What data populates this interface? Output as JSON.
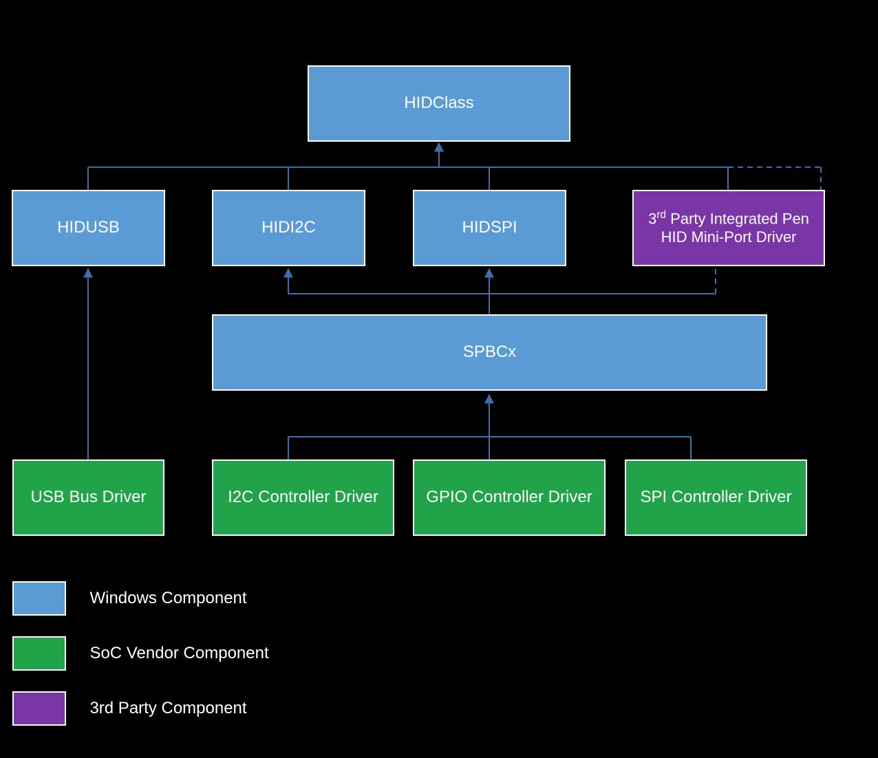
{
  "diagram": {
    "boxes": {
      "hidclass": "HIDClass",
      "hidusb": "HIDUSB",
      "hidi2c": "HIDI2C",
      "hidspi": "HIDSPI",
      "thirdparty_line1": "3",
      "thirdparty_sup": "rd",
      "thirdparty_rest1": " Party Integrated Pen",
      "thirdparty_line2": "HID Mini-Port Driver",
      "spbcx": "SPBCx",
      "usb_bus": "USB Bus Driver",
      "i2c_ctrl": "I2C Controller Driver",
      "gpio_ctrl": "GPIO Controller Driver",
      "spi_ctrl": "SPI Controller Driver"
    },
    "legend": {
      "windows": "Windows Component",
      "soc": "SoC Vendor Component",
      "thirdparty": "3rd Party Component"
    },
    "colors": {
      "blue": "#5B9BD5",
      "green": "#21A349",
      "purple": "#7A35A7",
      "line": "#3F6FA8"
    }
  }
}
